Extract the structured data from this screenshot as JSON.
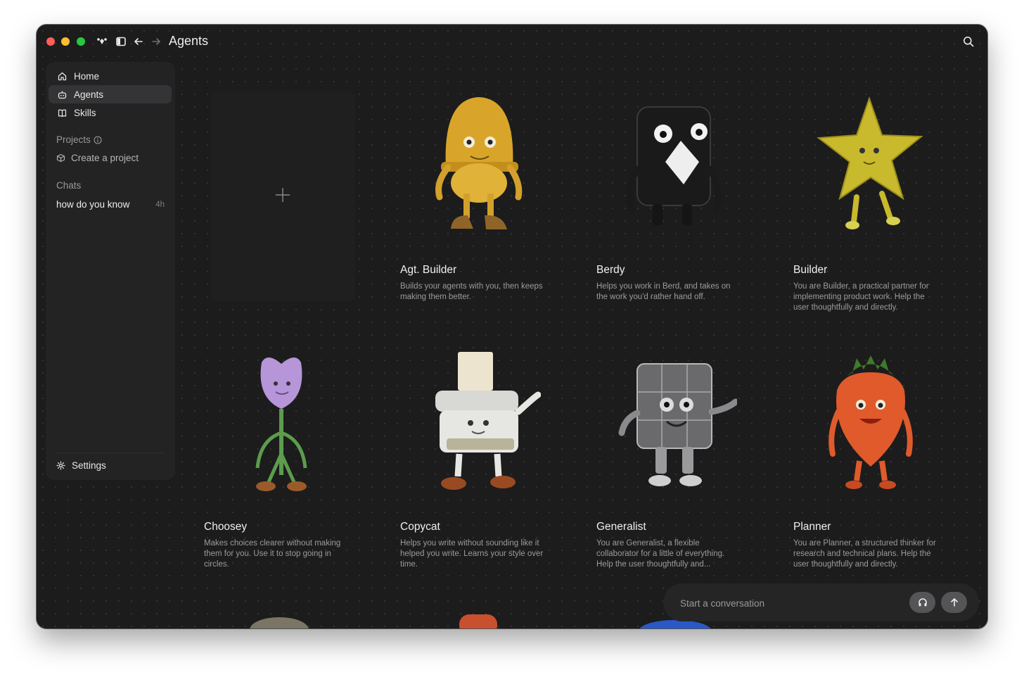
{
  "window": {
    "title": "Agents"
  },
  "sidebar": {
    "nav": [
      {
        "label": "Home",
        "icon": "home-icon"
      },
      {
        "label": "Agents",
        "icon": "robot-icon",
        "active": true
      },
      {
        "label": "Skills",
        "icon": "book-icon"
      }
    ],
    "projects_label": "Projects",
    "create_project_label": "Create a project",
    "chats_label": "Chats",
    "chats": [
      {
        "title": "how do you know",
        "time": "4h"
      }
    ],
    "settings_label": "Settings"
  },
  "agents": [
    {
      "name": "Agt. Builder",
      "description": "Builds your agents with you, then keeps making them better."
    },
    {
      "name": "Berdy",
      "description": "Helps you work in Berd, and takes on the work you'd rather hand off."
    },
    {
      "name": "Builder",
      "description": "You are Builder, a practical partner for implementing product work. Help the user thoughtfully and directly."
    },
    {
      "name": "Choosey",
      "description": "Makes choices clearer without making them for you. Use it to stop going in circles."
    },
    {
      "name": "Copycat",
      "description": "Helps you write without sounding like it helped you write. Learns your style over time."
    },
    {
      "name": "Generalist",
      "description": "You are Generalist, a flexible collaborator for a little of everything. Help the user thoughtfully and..."
    },
    {
      "name": "Planner",
      "description": "You are Planner, a structured thinker for research and technical plans. Help the user thoughtfully and directly."
    }
  ],
  "composer": {
    "placeholder": "Start a conversation"
  },
  "colors": {
    "window_bg": "#1c1c1d",
    "sidebar_bg": "#232324",
    "active_item": "#343436",
    "button": "#555557"
  }
}
